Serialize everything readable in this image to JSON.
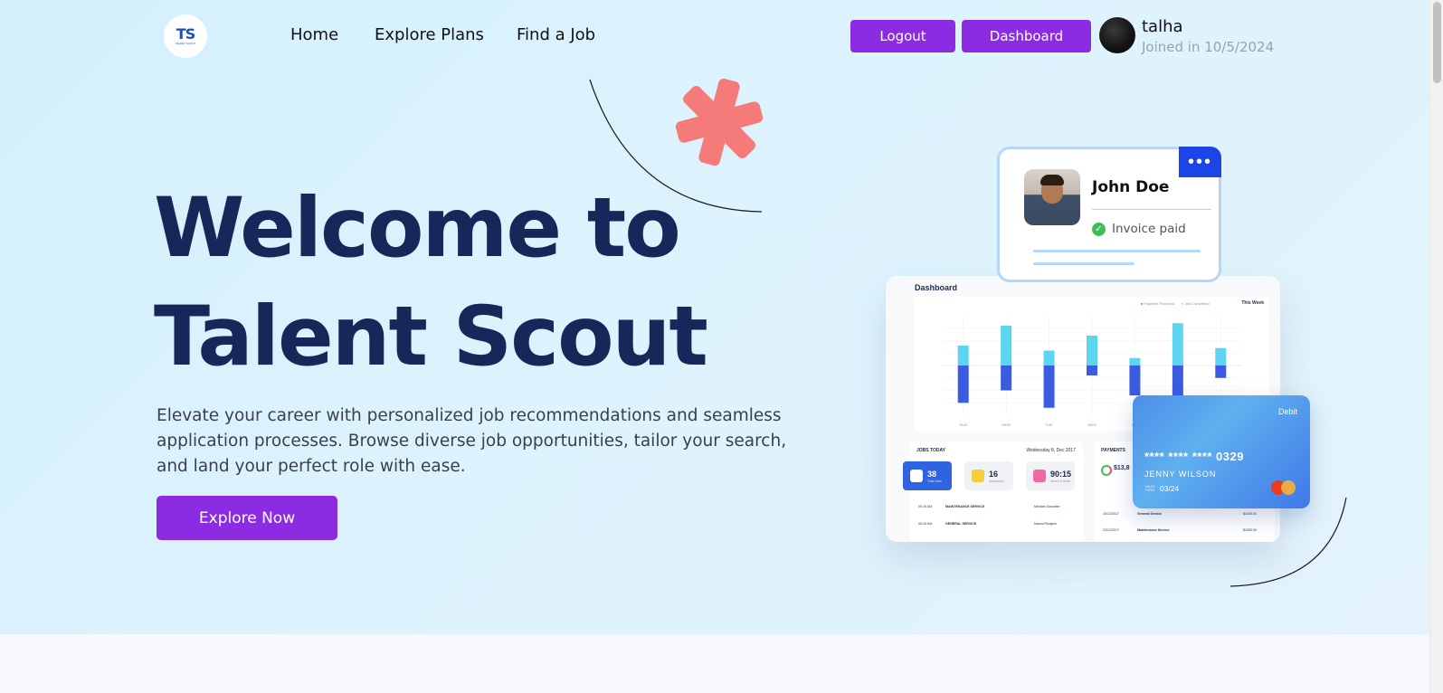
{
  "logo": {
    "mark": "TS",
    "tagline": "TALENT SCOUT"
  },
  "nav": {
    "links": [
      {
        "label": "Home"
      },
      {
        "label": "Explore Plans"
      },
      {
        "label": "Find a Job"
      }
    ],
    "logout_label": "Logout",
    "dashboard_label": "Dashboard",
    "user": {
      "name": "talha",
      "joined": "Joined in 10/5/2024"
    }
  },
  "hero": {
    "title_line1": "Welcome to",
    "title_line2": "Talent Scout",
    "description": "Elevate your career with personalized job recommendations and seamless application processes. Browse diverse job opportunities, tailor your search, and land your perfect role with ease.",
    "cta_label": "Explore Now"
  },
  "illustration": {
    "profile_card": {
      "name": "John Doe",
      "status": "Invoice paid",
      "menu": "•••"
    },
    "dashboard": {
      "title": "Dashboard",
      "legend": [
        "Payment Received",
        "Job Completed"
      ],
      "period": "This Week",
      "jobs_today": {
        "heading": "JOBS TODAY",
        "date": "Wednesday 8, Dec 2017",
        "stats": [
          {
            "value": "38",
            "label": "Total Jobs"
          },
          {
            "value": "16",
            "label": "Scheduled"
          },
          {
            "value": "90:15",
            "label": "Hours of Work"
          }
        ],
        "rows": [
          {
            "time": "09:15 AM",
            "service": "MAINTENANCE SERVICE",
            "worker": "Michael Gonzalez"
          },
          {
            "time": "09:15 AM",
            "service": "GENERAL SERVICE",
            "worker": "Naomi Rodgers"
          }
        ]
      },
      "payments": {
        "heading": "PAYMENTS",
        "amount": "$13,8",
        "rows": [
          {
            "date": "10/12/2017",
            "service": "General Service",
            "amount": "$3450.00"
          },
          {
            "date": "23/12/2017",
            "service": "Maintenance Service",
            "amount": "$4300.00"
          }
        ]
      }
    },
    "debit_card": {
      "type": "Debit",
      "number": "**** **** **** 0329",
      "holder": "JENNY WILSON",
      "valid_label": "VALID THRU",
      "expiry": "03/24"
    }
  },
  "chart_data": {
    "type": "bar",
    "categories": [
      "SUN",
      "MON",
      "TUE",
      "WED",
      "THU",
      "FRI",
      "SAT"
    ],
    "series": [
      {
        "name": "Payment Received",
        "values": [
          8,
          16,
          6,
          12,
          3,
          17,
          7
        ]
      },
      {
        "name": "Job Completed",
        "values": [
          -15,
          -10,
          -17,
          -4,
          -12,
          -14,
          -5
        ]
      }
    ],
    "colors": [
      "#5cd6f0",
      "#3b5ce0"
    ],
    "ylim": [
      -20,
      20
    ]
  }
}
